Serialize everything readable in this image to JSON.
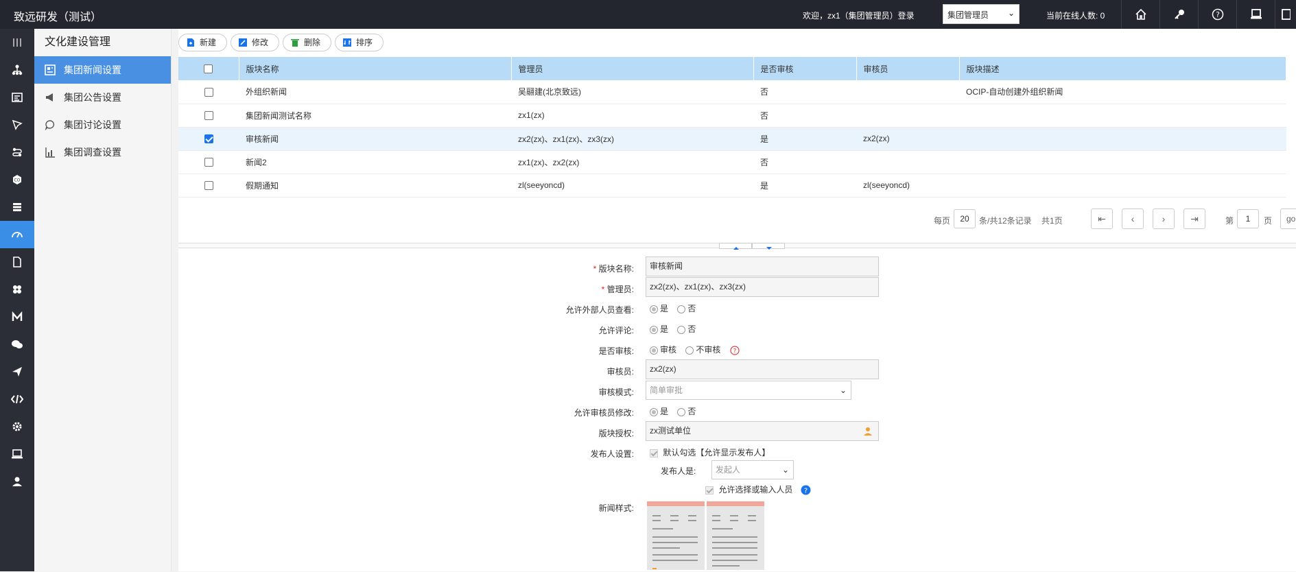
{
  "app": {
    "title": "致远研发（测试）",
    "welcome": "欢迎，zx1（集团管理员）登录",
    "role": "集团管理员",
    "online": "当前在线人数: 0"
  },
  "submenu": {
    "title": "文化建设管理",
    "items": [
      {
        "label": "集团新闻设置",
        "icon": "news-icon",
        "active": true
      },
      {
        "label": "集团公告设置",
        "icon": "megaphone-icon",
        "active": false
      },
      {
        "label": "集团讨论设置",
        "icon": "chat-bubble-icon",
        "active": false
      },
      {
        "label": "集团调查设置",
        "icon": "survey-chart-icon",
        "active": false
      }
    ]
  },
  "toolbar": {
    "new_label": "新建",
    "edit_label": "修改",
    "delete_label": "删除",
    "sort_label": "排序"
  },
  "table": {
    "headers": [
      "版块名称",
      "管理员",
      "是否审核",
      "审核员",
      "版块描述"
    ],
    "rows": [
      {
        "name": "外组织新闻",
        "admin": "吴翮建(北京致远)",
        "audit": "否",
        "auditor": "",
        "desc": "OCIP-自动创建外组织新闻",
        "checked": false
      },
      {
        "name": "集团新闻测试名称",
        "admin": "zx1(zx)",
        "audit": "否",
        "auditor": "",
        "desc": "",
        "checked": false
      },
      {
        "name": "审核新闻",
        "admin": "zx2(zx)、zx1(zx)、zx3(zx)",
        "audit": "是",
        "auditor": "zx2(zx)",
        "desc": "",
        "checked": true
      },
      {
        "name": "新闻2",
        "admin": "zx1(zx)、zx2(zx)",
        "audit": "否",
        "auditor": "",
        "desc": "",
        "checked": false
      },
      {
        "name": "假期通知",
        "admin": "zl(seeyoncd)",
        "audit": "是",
        "auditor": "zl(seeyoncd)",
        "desc": "",
        "checked": false
      }
    ]
  },
  "pager": {
    "per_page_label": "每页",
    "per_page": "20",
    "records": "条/共12条记录",
    "total_pages": "共1页",
    "page_prefix": "第",
    "page": "1",
    "page_suffix": "页",
    "go": "go"
  },
  "form": {
    "name_label": "版块名称:",
    "name_value": "审核新闻",
    "admin_label": "管理员:",
    "admin_value": "zx2(zx)、zx1(zx)、zx3(zx)",
    "external_label": "允许外部人员查看:",
    "comment_label": "允许评论:",
    "audit_label": "是否审核:",
    "audit_yes": "审核",
    "audit_no": "不审核",
    "auditor_label": "审核员:",
    "auditor_value": "zx2(zx)",
    "audit_mode_label": "审核模式:",
    "audit_mode_value": "简单审批",
    "auditor_edit_label": "允许审核员修改:",
    "auth_label": "版块授权:",
    "auth_value": "zx测试单位",
    "publisher_label": "发布人设置:",
    "publisher_default": "默认勾选【允许显示发布人】",
    "publisher_is_label": "发布人是:",
    "publisher_is_value": "发起人",
    "allow_select_label": "允许选择或输入人员",
    "style_label": "新闻样式:",
    "yes": "是",
    "no": "否"
  },
  "colors": {
    "topbar": "#23262e",
    "leftnav": "#2b2e36",
    "accent": "#4a90e2",
    "table_header": "#b8dcf7",
    "selected_row": "#eaf4fd"
  }
}
